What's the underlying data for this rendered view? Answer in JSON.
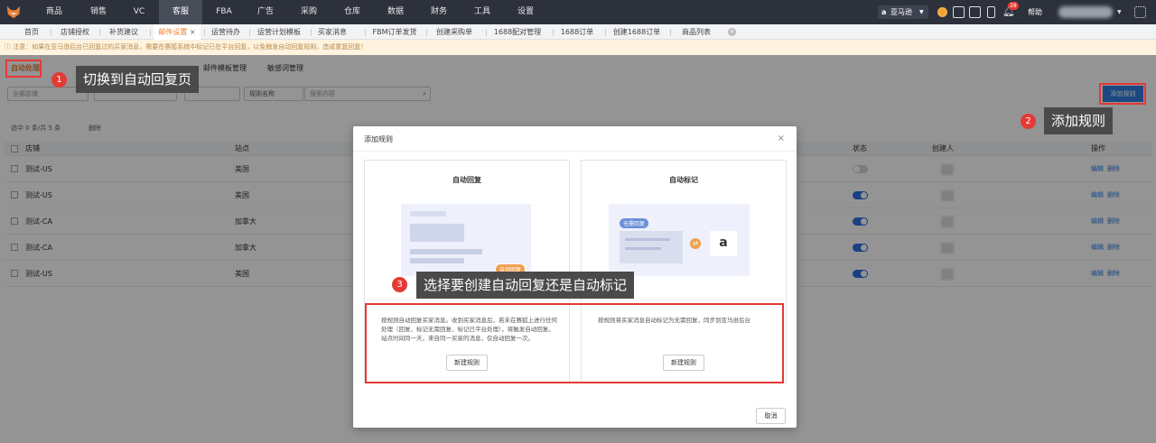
{
  "colors": {
    "nav_bg": "#2c313c",
    "accent": "#e8813a",
    "primary": "#2f7de1",
    "annotation_red": "#e53935"
  },
  "topnav": {
    "items": [
      "商品",
      "销售",
      "VC",
      "客服",
      "FBA",
      "广告",
      "采购",
      "仓库",
      "数据",
      "财务",
      "工具",
      "设置"
    ],
    "active": "客服",
    "marketplace": "亚马逊",
    "notification_count": "28",
    "help": "帮助"
  },
  "tabs": [
    "首页",
    "店铺授权",
    "补货建议",
    "邮件设置",
    "运营待办",
    "运营计划模板",
    "买家消息",
    "FBM订单发货",
    "创建采购单",
    "1688配对管理",
    "1688订单",
    "创建1688订单",
    "商品列表"
  ],
  "active_tab": "邮件设置",
  "notice": "注意：如果在亚马逊后台已回复过的买家消息，需要在赛狐系统中标记已在平台回复，以免触发自动回复规则，造成重复回复！",
  "subtabs": [
    "自动处理",
    "邮件模板管理",
    "敏感词管理"
  ],
  "filters": {
    "store": "全部店铺",
    "rule_name": "规则名称",
    "search_placeholder": "搜索内容"
  },
  "add_rule": "添加规则",
  "selection": {
    "prefix": "选中",
    "selected": "0",
    "mid": "条/共",
    "total": "5",
    "suffix": "条",
    "delete": "删除"
  },
  "table": {
    "headers": {
      "store": "店铺",
      "site": "站点",
      "status": "状态",
      "creator": "创建人",
      "ops": "操作"
    },
    "rows": [
      {
        "store": "测试-US",
        "site": "美国",
        "on": false
      },
      {
        "store": "测试-US",
        "site": "美国",
        "on": true
      },
      {
        "store": "测试-CA",
        "site": "加拿大",
        "on": true
      },
      {
        "store": "测试-CA",
        "site": "加拿大",
        "on": true
      },
      {
        "store": "测试-US",
        "site": "美国",
        "on": true
      }
    ],
    "edit": "编辑",
    "delete": "删除"
  },
  "modal": {
    "title": "添加规则",
    "close": "×",
    "auto_reply": {
      "title": "自动回复",
      "badge": "自动回复",
      "desc": "按规则自动回复买家消息。收到买家消息后，若未在赛狐上进行任何处理（回复、标记无需回复、标记已平台处理），将触发自动回复。站点时间同一天，来自同一买家的消息，仅自动回复一次。",
      "button": "新建规则"
    },
    "auto_mark": {
      "title": "自动标记",
      "badge": "无需回复",
      "desc": "按规则将买家消息自动标记为无需回复，同步到亚马逊后台",
      "button": "新建规则"
    },
    "cancel": "取消"
  },
  "annotations": {
    "step1": {
      "num": "1",
      "text": "切换到自动回复页"
    },
    "step2": {
      "num": "2",
      "text": "添加规则"
    },
    "step3": {
      "num": "3",
      "text": "选择要创建自动回复还是自动标记"
    }
  }
}
